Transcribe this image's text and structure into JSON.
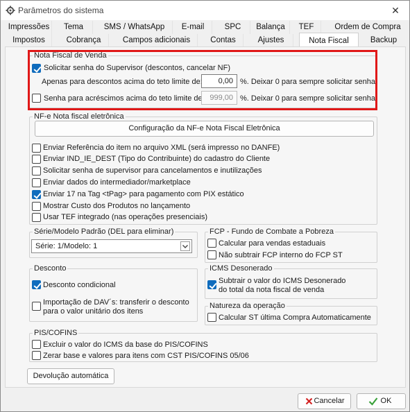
{
  "window": {
    "title": "Parâmetros do sistema"
  },
  "tabs_row1": [
    "Impressões",
    "Tema",
    "SMS / WhatsApp",
    "E-mail",
    "SPC",
    "Balança",
    "TEF",
    "Ordem de Compra"
  ],
  "tabs_row2": [
    "Impostos",
    "Cobrança",
    "Campos adicionais",
    "Contas",
    "Ajustes",
    "Nota Fiscal",
    "Backup"
  ],
  "nota_fiscal_venda": {
    "legend": "Nota Fiscal de Venda",
    "solicitar_senha": "Solicitar senha do Supervisor (descontos, cancelar NF)",
    "apenas_descontos": "Apenas para descontos acima do teto limite de:",
    "desconto_value": "0,00",
    "desconto_suffix": "%. Deixar 0 para sempre solicitar senha",
    "senha_acrescimos": "Senha para acréscimos acima do teto limite de:",
    "acrescimo_value": "999,00",
    "acrescimo_suffix": "%. Deixar 0 para sempre solicitar senha"
  },
  "nfe": {
    "legend": "NF-e Nota fiscal eletrônica",
    "config_button": "Configuração da NF-e Nota Fiscal Eletrônica",
    "options": [
      "Enviar Referência do item no arquivo XML (será impresso no DANFE)",
      "Enviar IND_IE_DEST (Tipo do Contribuinte) do cadastro do Cliente",
      "Solicitar senha de supervisor para cancelamentos e inutilizações",
      "Enviar dados do intermediador/marketplace",
      "Enviar 17 na Tag <tPag> para pagamento com PIX estático",
      "Mostrar Custo dos Produtos no lançamento",
      "Usar TEF integrado (nas operações presenciais)"
    ]
  },
  "serie": {
    "legend": "Série/Modelo Padrão (DEL para eliminar)",
    "selected": "Série: 1/Modelo: 1"
  },
  "fcp": {
    "legend": "FCP - Fundo de Combate a Pobreza",
    "opt1": "Calcular para vendas estaduais",
    "opt2": "Não subtrair FCP interno do FCP ST"
  },
  "desconto": {
    "legend": "Desconto",
    "condicional": "Desconto condicional",
    "importacao_line1": "Importação de DAV´s: transferir o desconto",
    "importacao_line2": "para o valor unitário dos itens"
  },
  "icms": {
    "legend": "ICMS Desonerado",
    "line1": "Subtrair o valor do ICMS Desonerado",
    "line2": "do total da nota fiscal de venda"
  },
  "natureza": {
    "legend": "Natureza da operação",
    "opt1": "Calcular ST última Compra Automaticamente"
  },
  "pis": {
    "legend": "PIS/COFINS",
    "opt1": "Excluir o valor do ICMS da base do PIS/COFINS",
    "opt2": "Zerar base e valores para itens com CST PIS/COFINS 05/06"
  },
  "devolucao_button": "Devolução automática",
  "footer": {
    "cancel": "Cancelar",
    "ok": "OK"
  },
  "colors": {
    "accent": "#0f6cbd",
    "highlight": "#e01818"
  }
}
